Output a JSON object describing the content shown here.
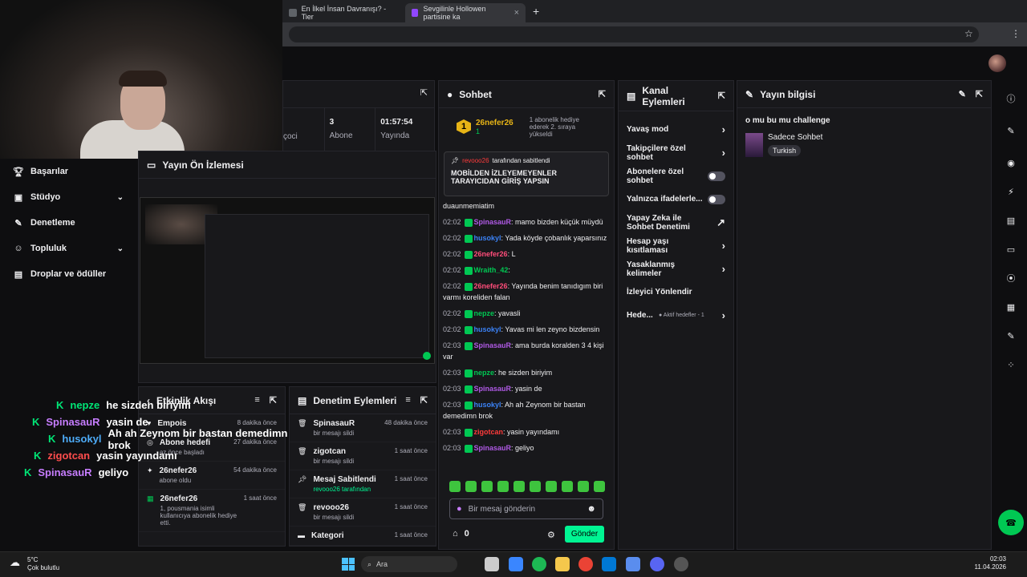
{
  "browser": {
    "tabs": [
      {
        "title": "En İlkel İnsan Davranışı? - Tier"
      },
      {
        "title": "Sevgilinle Hollowen partisine ka"
      }
    ],
    "new_tab": "+"
  },
  "colors": {
    "accent": "#9147ff",
    "green": "#00f593",
    "panel": "#18181b",
    "bg": "#0e0e10"
  },
  "nav": [
    {
      "label": "Başarılar",
      "icon": "trophy-icon"
    },
    {
      "label": "Stüdyo",
      "icon": "video-icon",
      "chev": "⌄"
    },
    {
      "label": "Denetleme",
      "icon": "wrench-icon"
    },
    {
      "label": "Topluluk",
      "icon": "users-icon",
      "chev": "⌄"
    },
    {
      "label": "Droplar ve ödüller",
      "icon": "gift-icon"
    }
  ],
  "stats": {
    "a_label": "çoci",
    "b_value": "3",
    "b_label": "Abone",
    "c_value": "01:57:54",
    "c_label": "Yayında"
  },
  "preview": {
    "title": "Yayın Ön İzlemesi"
  },
  "activity": {
    "title": "Etkinlik Akışı",
    "items": [
      {
        "name": "Empois",
        "time": "8 dakika önce",
        "sub": ""
      },
      {
        "name": "Abone hedefi",
        "time": "27 dakika önce",
        "sub": "az önce başladı"
      },
      {
        "name": "26nefer26",
        "time": "54 dakika önce",
        "sub": "abone oldu"
      },
      {
        "name": "26nefer26",
        "time": "1 saat önce",
        "sub": "1, pousmania isimli kullanıcıya abonelik hediye etti."
      }
    ]
  },
  "moderation": {
    "title": "Denetim Eylemleri",
    "items": [
      {
        "name": "SpinasauR",
        "time": "48 dakika önce",
        "sub": "bir mesajı sildi"
      },
      {
        "name": "zigotcan",
        "time": "1 saat önce",
        "sub": "bir mesajı sildi"
      },
      {
        "name": "Mesaj Sabitlendi",
        "time": "1 saat önce",
        "sub": "revooo26 tarafından"
      },
      {
        "name": "revooo26",
        "time": "1 saat önce",
        "sub": "bir mesajı sildi"
      },
      {
        "name": "Kategori",
        "time": "1 saat önce",
        "sub": ""
      }
    ]
  },
  "chat": {
    "title": "Sohbet",
    "hype_user": "26nefer26",
    "hype_count": "1",
    "hype_text": "1 abonelik hediye ederek 2. sıraya yükseldi",
    "pinned_by": "revooo26",
    "pinned_by_suffix": "tarafından sabitlendi",
    "pinned_text": "MOBİLDEN İZLEYEMEYENLER TARAYICIDAN GİRİŞ YAPSIN",
    "input_placeholder": "Bir mesaj gönderin",
    "points": "0",
    "send": "Gönder",
    "messages": [
      {
        "ts": "",
        "user": "",
        "color": "#efeff1",
        "text": "duaunmemiatim"
      },
      {
        "ts": "02:02",
        "user": "SpinasauR",
        "color": "#b05ae6",
        "text": ": mamo bizden küçük müydü"
      },
      {
        "ts": "02:02",
        "user": "husokyl",
        "color": "#3b82f6",
        "text": ": Yada köyde çobanlık yaparsınız"
      },
      {
        "ts": "02:02",
        "user": "26nefer26",
        "color": "#ff4d7a",
        "text": ": L"
      },
      {
        "ts": "02:02",
        "user": "Wraith_42",
        "color": "#00c853",
        "text": ":"
      },
      {
        "ts": "02:02",
        "user": "26nefer26",
        "color": "#ff4d7a",
        "text": ": Yayında benim tanıdıgım biri varmı koreliden falan"
      },
      {
        "ts": "02:02",
        "user": "nepze",
        "color": "#00c853",
        "text": ": yavasli"
      },
      {
        "ts": "02:02",
        "user": "husokyl",
        "color": "#3b82f6",
        "text": ": Yavas mi len zeyno bizdensin"
      },
      {
        "ts": "02:03",
        "user": "SpinasauR",
        "color": "#b05ae6",
        "text": ": ama burda koralden 3 4 kişi var"
      },
      {
        "ts": "02:03",
        "user": "nepze",
        "color": "#00c853",
        "text": ": he sizden biriyim"
      },
      {
        "ts": "02:03",
        "user": "SpinasauR",
        "color": "#b05ae6",
        "text": ": yasin de"
      },
      {
        "ts": "02:03",
        "user": "husokyl",
        "color": "#3b82f6",
        "text": ": Ah ah Zeynom bir bastan demedimn brok"
      },
      {
        "ts": "02:03",
        "user": "zigotcan",
        "color": "#ff3b3b",
        "text": ": yasin yayındamı"
      },
      {
        "ts": "02:03",
        "user": "SpinasauR",
        "color": "#b05ae6",
        "text": ": geliyo"
      }
    ]
  },
  "channel_actions": {
    "title": "Kanal Eylemleri",
    "items": [
      {
        "label": "Yavaş mod",
        "ctl": "›"
      },
      {
        "label": "Takipçilere özel sohbet",
        "ctl": "›"
      },
      {
        "label": "Abonelere özel sohbet",
        "ctl": "toggle"
      },
      {
        "label": "Yalnızca ifadelerle...",
        "ctl": "toggle"
      },
      {
        "label": "Yapay Zeka ile Sohbet Denetimi",
        "ctl": "↗"
      },
      {
        "label": "Hesap yaşı kısıtlaması",
        "ctl": "›"
      },
      {
        "label": "Yasaklanmış kelimeler",
        "ctl": "›"
      },
      {
        "label": "İzleyici Yönlendir",
        "ctl": ""
      },
      {
        "label": "Hede...",
        "ctl": "›",
        "extra": "● Aktif hedefler - 1"
      }
    ]
  },
  "stream_info": {
    "title": "Yayın bilgisi",
    "stream_title": "o mu bu mu challenge",
    "category": "Sadece Sohbet",
    "tag": "Turkish"
  },
  "overlay": [
    {
      "user": "nepze",
      "color": "#00e676",
      "text": "he sizden biriyim"
    },
    {
      "user": "SpinasauR",
      "color": "#c77dff",
      "text": "yasin de"
    },
    {
      "user": "husokyl",
      "color": "#4dabf7",
      "text": "Ah ah Zeynom bir bastan demedimn brok"
    },
    {
      "user": "zigotcan",
      "color": "#ff4d4d",
      "text": "yasin yayındamı"
    },
    {
      "user": "SpinasauR",
      "color": "#c77dff",
      "text": "geliyo"
    }
  ],
  "taskbar": {
    "temp": "5°C",
    "weather": "Çok bulutlu",
    "search": "Ara",
    "time": "02:03",
    "date": "11.04.2026"
  }
}
